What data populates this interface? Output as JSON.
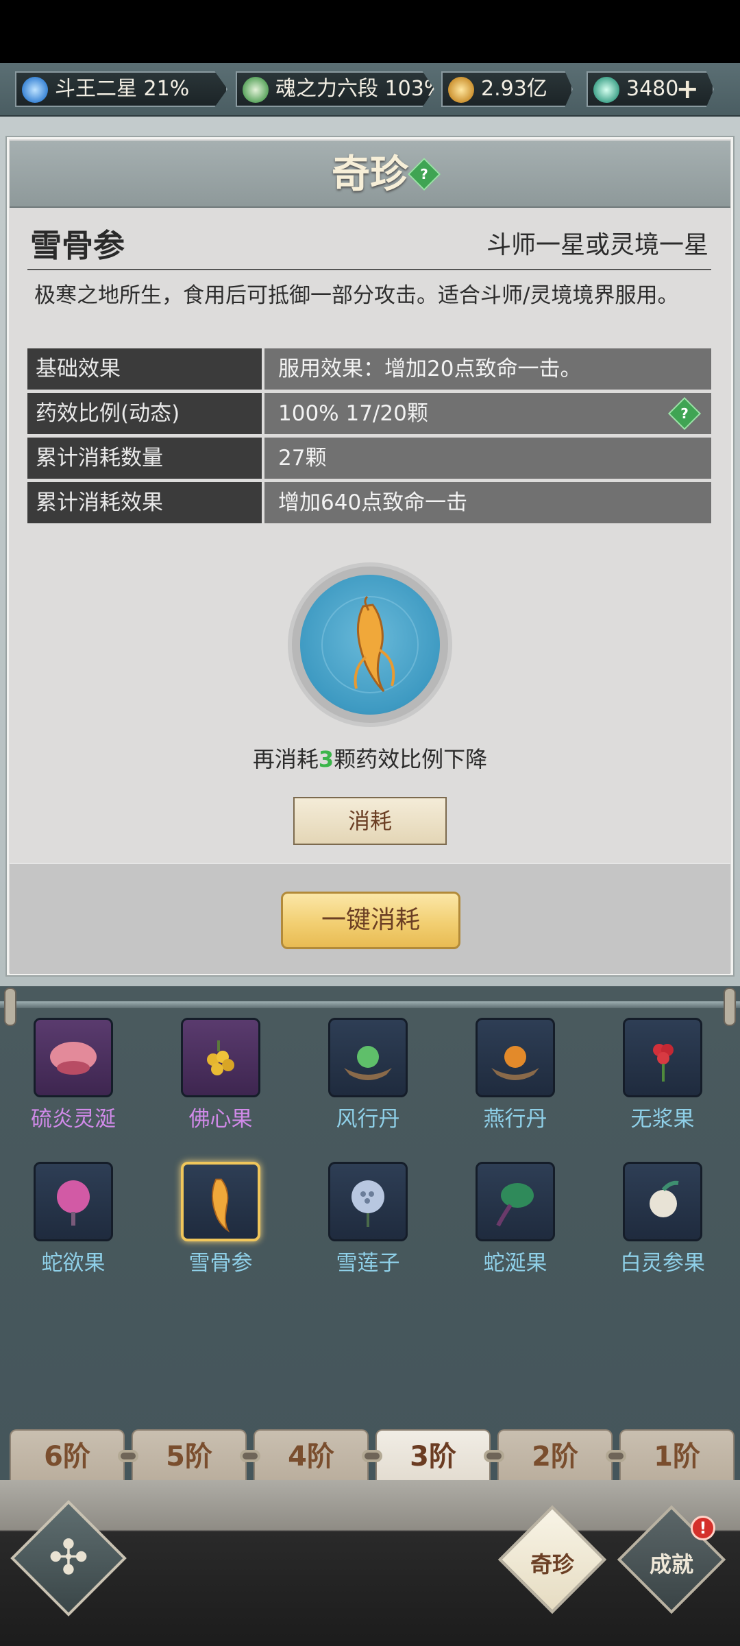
{
  "resources": [
    {
      "label": "斗王二星 21%",
      "icon": "flame-rank-icon",
      "color": "#5fa8e8"
    },
    {
      "label": "魂之力六段 103%",
      "icon": "soul-swirl-icon",
      "color": "#79c27a"
    },
    {
      "label": "2.93亿",
      "icon": "gold-coin-icon",
      "color": "#e6b347"
    },
    {
      "label": "3480",
      "icon": "jade-gem-icon",
      "color": "#4fb9a1",
      "plus": "+"
    }
  ],
  "panel": {
    "title": "奇珍",
    "item_name": "雪骨参",
    "requirement": "斗师一星或灵境一星",
    "description": "极寒之地所生，食用后可抵御一部分攻击。适合斗师/灵境境界服用。",
    "stats": [
      {
        "key": "基础效果",
        "value": "服用效果：增加20点致命一击。"
      },
      {
        "key": "药效比例(动态)",
        "value": "100% 17/20颗"
      },
      {
        "key": "累计消耗数量",
        "value": "27颗"
      },
      {
        "key": "累计消耗效果",
        "value": "增加640点致命一击"
      }
    ],
    "consume_note_prefix": "再消耗",
    "consume_note_count": "3",
    "consume_note_suffix": "颗药效比例下降",
    "consume_button": "消耗",
    "consume_all_button": "一键消耗"
  },
  "inventory": [
    {
      "name": "硫炎灵涎",
      "style": "purple"
    },
    {
      "name": "佛心果",
      "style": "purple"
    },
    {
      "name": "风行丹",
      "style": "blue"
    },
    {
      "name": "燕行丹",
      "style": "blue"
    },
    {
      "name": "无浆果",
      "style": "blue"
    },
    {
      "name": "蛇欲果",
      "style": "blue"
    },
    {
      "name": "雪骨参",
      "style": "blue",
      "selected": true
    },
    {
      "name": "雪莲子",
      "style": "blue"
    },
    {
      "name": "蛇涎果",
      "style": "blue"
    },
    {
      "name": "白灵参果",
      "style": "blue"
    }
  ],
  "tiers": [
    "6阶",
    "5阶",
    "4阶",
    "3阶",
    "2阶",
    "1阶"
  ],
  "active_tier": "3阶",
  "nav": {
    "treasure": "奇珍",
    "achievement": "成就",
    "badge": "!"
  },
  "help_icon": "?"
}
